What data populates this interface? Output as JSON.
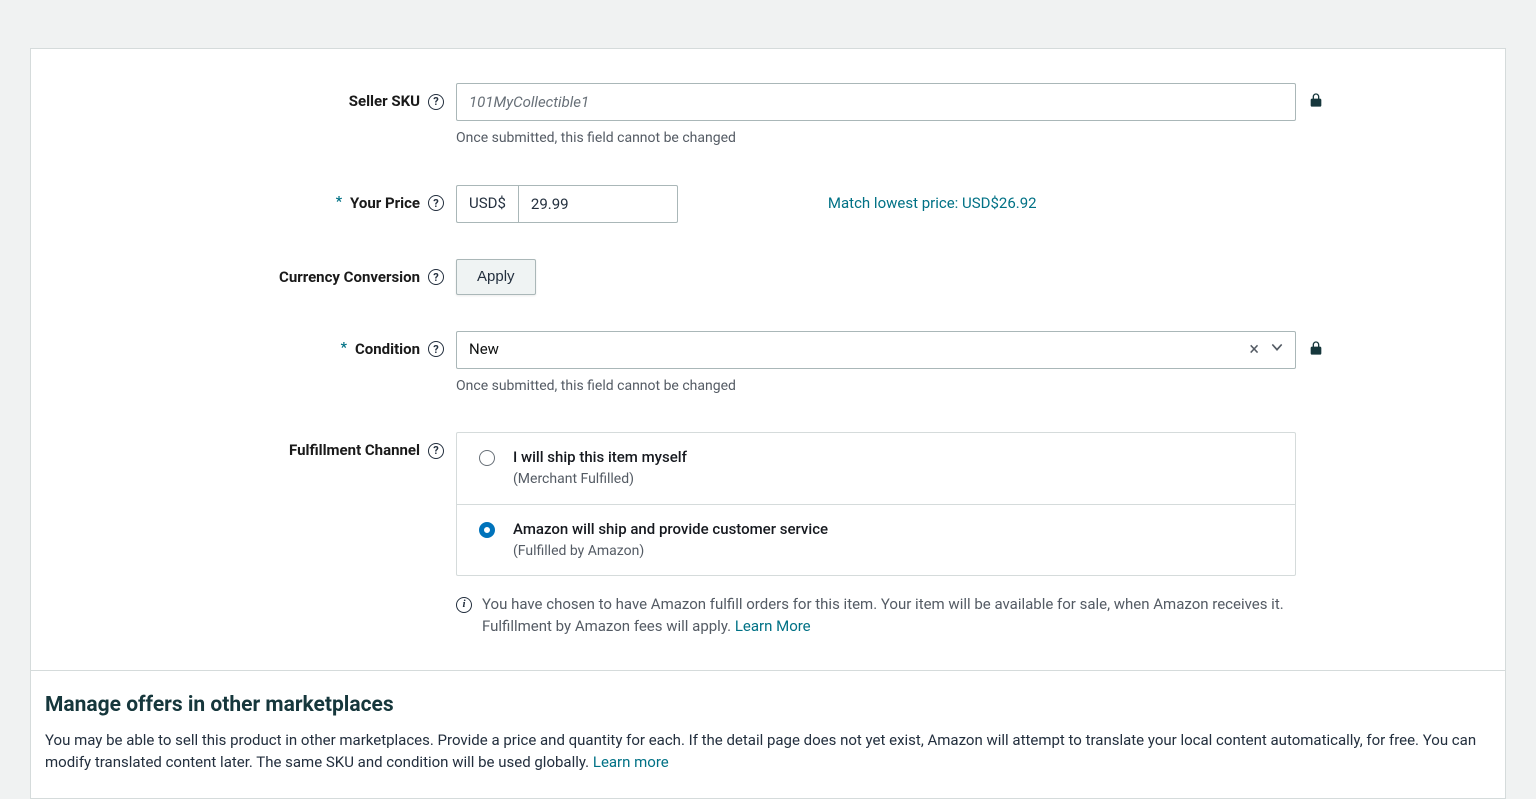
{
  "form": {
    "sku": {
      "label": "Seller SKU",
      "placeholder": "101MyCollectible1",
      "hint": "Once submitted, this field cannot be changed"
    },
    "price": {
      "label": "Your Price",
      "currency": "USD$",
      "value": "29.99",
      "match_link": "Match lowest price: USD$26.92"
    },
    "currency_conversion": {
      "label": "Currency Conversion",
      "apply": "Apply"
    },
    "condition": {
      "label": "Condition",
      "value": "New",
      "hint": "Once submitted, this field cannot be changed"
    },
    "fulfillment": {
      "label": "Fulfillment Channel",
      "options": [
        {
          "title": "I will ship this item myself",
          "sub": "(Merchant Fulfilled)",
          "selected": false
        },
        {
          "title": "Amazon will ship and provide customer service",
          "sub": "(Fulfilled by Amazon)",
          "selected": true
        }
      ],
      "info": "You have chosen to have Amazon fulfill orders for this item. Your item will be available for sale, when Amazon receives it. Fulfillment by Amazon fees will apply. ",
      "learn_more": "Learn More"
    }
  },
  "section2": {
    "title": "Manage offers in other marketplaces",
    "body": "You may be able to sell this product in other marketplaces. Provide a price and quantity for each. If the detail page does not yet exist, Amazon will attempt to translate your local content automatically, for free. You can modify translated content later. The same SKU and condition will be used globally. ",
    "learn_more": "Learn more"
  }
}
